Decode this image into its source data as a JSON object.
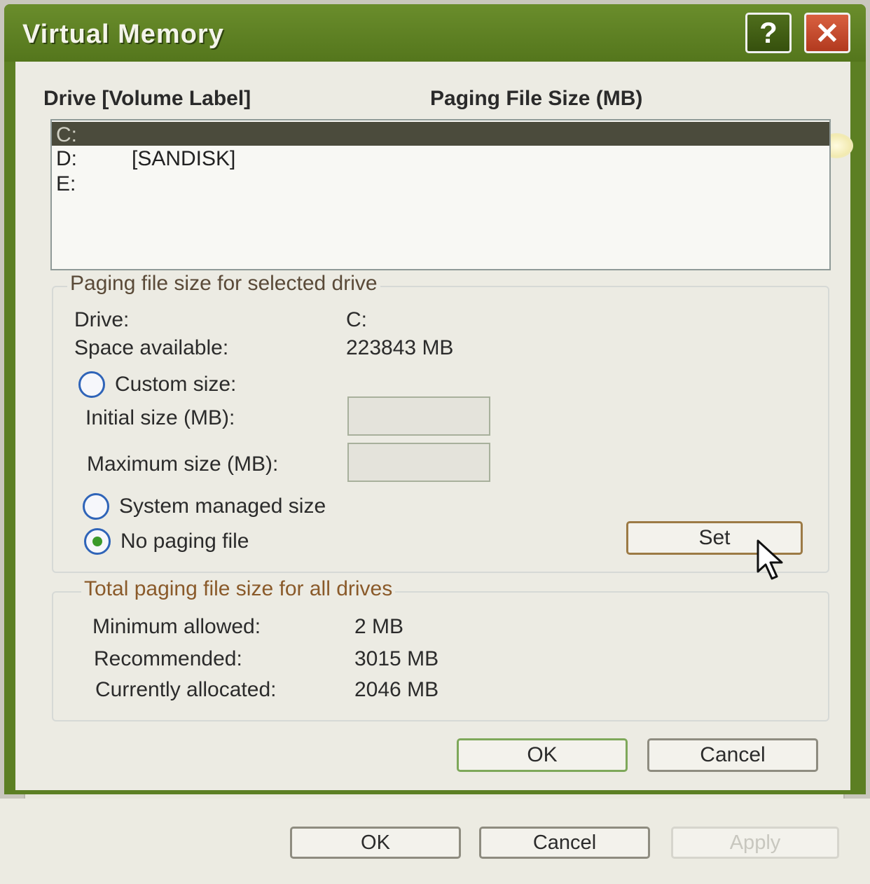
{
  "dialog": {
    "title": "Virtual Memory",
    "help_glyph": "?",
    "close_glyph": "✕"
  },
  "list": {
    "header_drive": "Drive  [Volume Label]",
    "header_size": "Paging File Size (MB)",
    "rows": [
      {
        "drive": "C:",
        "label": "",
        "selected": true
      },
      {
        "drive": "D:",
        "label": "[SANDISK]",
        "selected": false
      },
      {
        "drive": "E:",
        "label": "",
        "selected": false
      }
    ]
  },
  "selected_drive": {
    "group_title": "Paging file size for selected drive",
    "drive_label": "Drive:",
    "drive_value": "C:",
    "space_label": "Space available:",
    "space_value": "223843 MB",
    "custom_size_label": "Custom size:",
    "initial_label": "Initial size (MB):",
    "initial_value": "",
    "maximum_label": "Maximum size (MB):",
    "maximum_value": "",
    "system_managed_label": "System managed size",
    "no_paging_label": "No paging file",
    "selected_option": "No paging file",
    "set_label": "Set"
  },
  "totals": {
    "group_title": "Total paging file size for all drives",
    "min_label": "Minimum allowed:",
    "min_value": "2 MB",
    "rec_label": "Recommended:",
    "rec_value": "3015 MB",
    "cur_label": "Currently allocated:",
    "cur_value": "2046 MB"
  },
  "buttons": {
    "ok": "OK",
    "cancel": "Cancel"
  },
  "parent_buttons": {
    "ok": "OK",
    "cancel": "Cancel",
    "apply": "Apply"
  },
  "colors": {
    "title_bar": "#5c7f23",
    "selection": "#4b4b3c",
    "group_title_orange": "#8a5a2a"
  }
}
